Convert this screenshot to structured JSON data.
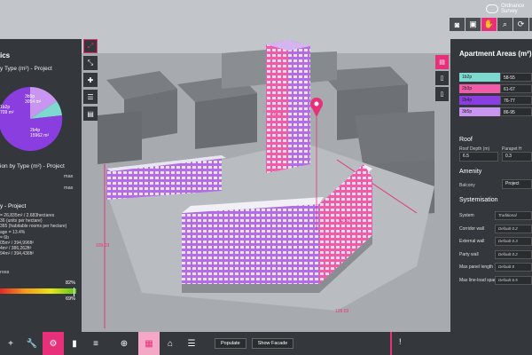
{
  "brand": {
    "line1": "Ordnance",
    "line2": "Survey"
  },
  "top_toolbar": [
    {
      "name": "camera-icon",
      "glyph": "◙"
    },
    {
      "name": "image-icon",
      "glyph": "▣"
    },
    {
      "name": "hand-icon",
      "glyph": "✋"
    },
    {
      "name": "zoom-icon",
      "glyph": "⌕"
    },
    {
      "name": "rotate-icon",
      "glyph": "⟳"
    },
    {
      "name": "fullscreen-icon",
      "glyph": "⛶"
    }
  ],
  "left_panel": {
    "title": "ics",
    "pie_title": "y Type (m²) - Project",
    "pie_labels": {
      "p3b5": "3b5p\n3054 m²",
      "p1b2": "1b2p\n709 m²",
      "p2b4": "2b4p\n15962 m²"
    },
    "dist_title": "ion by Type (m²) - Project",
    "max1": "max",
    "max2": "max",
    "project_label": "y - Project",
    "stats": [
      "= 26,835m² / 2.683hectares",
      "36 (units per hectare)",
      "365 (habitable rooms per hectare)",
      "age = 13.4%",
      "= 6b",
      "05m² / 394,996ft²",
      "4m² / 386,262ft²",
      "94m² / 394,436ft²"
    ],
    "gross_label": "ross",
    "pct_top": "82%",
    "pct_bottom": "69%"
  },
  "side_icons": [
    {
      "name": "expand-icon",
      "glyph": "⤢"
    },
    {
      "name": "collapse-icon",
      "glyph": "⤡"
    },
    {
      "name": "puzzle-icon",
      "glyph": "✚"
    },
    {
      "name": "sliders-icon",
      "glyph": "☰"
    },
    {
      "name": "comment-icon",
      "glyph": "▤"
    }
  ],
  "right_tabs": [
    {
      "name": "document-icon",
      "glyph": "▤"
    },
    {
      "name": "phone-icon",
      "glyph": "▯"
    },
    {
      "name": "tablet-icon",
      "glyph": "▯"
    }
  ],
  "right_panel": {
    "title": "Apartment Areas (m²)",
    "apartments": [
      {
        "type": "1b2p",
        "range": "58-55",
        "color": "#7fd8d0"
      },
      {
        "type": "2b3p",
        "range": "61-67",
        "color": "#f05ca8"
      },
      {
        "type": "2b4p",
        "range": "76-77",
        "color": "#8a3ee0"
      },
      {
        "type": "3b5p",
        "range": "86-95",
        "color": "#c896f0"
      }
    ],
    "roof_heading": "Roof",
    "roof_depth_label": "Roof Depth (m)",
    "roof_depth_value": "6.5",
    "parapet_label": "Parapet H",
    "parapet_value": "0.3",
    "amenity_heading": "Amenity",
    "amenity_type": "Balcony",
    "amenity_value": "Project",
    "systemisation_heading": "Systemisation",
    "system_rows": [
      {
        "label": "System",
        "value": "Traditional"
      },
      {
        "label": "Corridor wall",
        "value": "Default 0.2"
      },
      {
        "label": "External wall",
        "value": "Default 0.3"
      },
      {
        "label": "Party wall",
        "value": "Default 0.2"
      },
      {
        "label": "Max panel length",
        "value": "Default 8"
      },
      {
        "label": "Max line-load span",
        "value": "Default 6.5"
      }
    ]
  },
  "bottom_bar": {
    "icons": [
      {
        "name": "add-icon",
        "glyph": "+"
      },
      {
        "name": "wrench-icon",
        "glyph": "🔧"
      },
      {
        "name": "settings-icon",
        "glyph": "⚙"
      },
      {
        "name": "chart-icon",
        "glyph": "▮"
      },
      {
        "name": "layers-icon",
        "glyph": "≡"
      },
      {
        "name": "globe-icon",
        "glyph": "⊕"
      },
      {
        "name": "building-icon",
        "glyph": "▦"
      },
      {
        "name": "home-icon",
        "glyph": "⌂"
      },
      {
        "name": "list-icon",
        "glyph": "☰"
      }
    ],
    "populate_label": "Populate",
    "facade_label": "Show Facade",
    "more_glyph": "!"
  },
  "scene_labels": {
    "dim_left": "109.03",
    "dim_bottom": "109.03",
    "dim_right": "63.53",
    "dim_center": "36.00"
  },
  "colors": {
    "accent": "#e8307a",
    "panel": "#34373b"
  }
}
